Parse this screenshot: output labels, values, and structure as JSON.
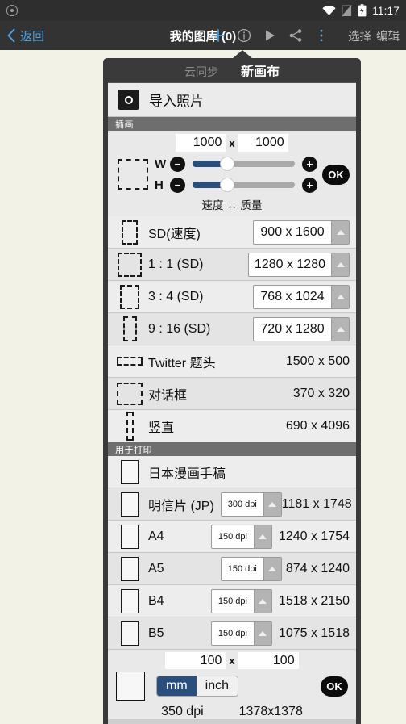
{
  "statusbar": {
    "shield_icon": "shield-icon",
    "wifi_icon": "wifi-icon",
    "signal_off_icon": "signal-no-sim-icon",
    "battery_icon": "battery-charging-icon",
    "time": "11:17"
  },
  "navbar": {
    "back_icon": "chevron-left-icon",
    "back_label": "返回",
    "title": "我的图库 (0)",
    "add_icon": "plus-icon",
    "info_icon": "info-circle-icon",
    "play_icon": "play-icon",
    "share_icon": "share-icon",
    "overflow_icon": "more-vertical-icon",
    "select_label": "选择",
    "edit_label": "编辑",
    "accent_color": "#4c9fe0"
  },
  "dialog": {
    "tab_cloud": "云同步",
    "tab_newcanvas": "新画布",
    "import": {
      "icon": "camera-icon",
      "label": "导入照片"
    },
    "section_illustration": "插画",
    "section_print": "用于打印",
    "canvas_sliders": {
      "width_value": "1000",
      "height_value": "1000",
      "separator": "x",
      "w_label": "W",
      "h_label": "H",
      "minus_icon": "minus-icon",
      "plus_icon": "plus-icon",
      "ok_label": "OK",
      "speed_quality_label": "速度 ↔ 质量",
      "w_fill_percent": 34,
      "h_fill_percent": 34
    },
    "illustration_presets": [
      {
        "label": "SD(速度)",
        "size": "900 x 1600",
        "spinner": true,
        "icon": "canvas-preview-dashed-portrait"
      },
      {
        "label": "1 : 1 (SD)",
        "size": "1280 x 1280",
        "spinner": true,
        "icon": "canvas-preview-dashed-square"
      },
      {
        "label": "3 : 4 (SD)",
        "size": "768 x 1024",
        "spinner": true,
        "icon": "canvas-preview-dashed-3x4"
      },
      {
        "label": "9 : 16 (SD)",
        "size": "720 x 1280",
        "spinner": true,
        "icon": "canvas-preview-dashed-9x16"
      },
      {
        "label": "Twitter 题头",
        "size": "1500 x 500",
        "spinner": false,
        "icon": "canvas-preview-dashed-wide"
      },
      {
        "label": "对话框",
        "size": "370 x 320",
        "spinner": false,
        "icon": "canvas-preview-dashed-box"
      },
      {
        "label": "竖直",
        "size": "690 x 4096",
        "spinner": false,
        "icon": "canvas-preview-dashed-tall"
      }
    ],
    "print_presets": [
      {
        "label": "日本漫画手稿",
        "dpi": "",
        "size": "",
        "icon": "canvas-preview-solid-portrait"
      },
      {
        "label": "明信片 (JP)",
        "dpi": "300 dpi",
        "size": "1181 x 1748",
        "icon": "canvas-preview-solid-portrait"
      },
      {
        "label": "A4",
        "dpi": "150 dpi",
        "size": "1240 x 1754",
        "icon": "canvas-preview-solid-portrait"
      },
      {
        "label": "A5",
        "dpi": "150 dpi",
        "size": "874 x 1240",
        "icon": "canvas-preview-solid-portrait"
      },
      {
        "label": "B4",
        "dpi": "150 dpi",
        "size": "1518 x 2150",
        "icon": "canvas-preview-solid-portrait"
      },
      {
        "label": "B5",
        "dpi": "150 dpi",
        "size": "1075 x 1518",
        "icon": "canvas-preview-solid-portrait"
      }
    ],
    "custom": {
      "width_value": "100",
      "height_value": "100",
      "separator": "x",
      "unit_mm": "mm",
      "unit_inch": "inch",
      "selected_unit": "mm",
      "ok_label": "OK",
      "dpi": "350 dpi",
      "pixels": "1378x1378"
    }
  }
}
